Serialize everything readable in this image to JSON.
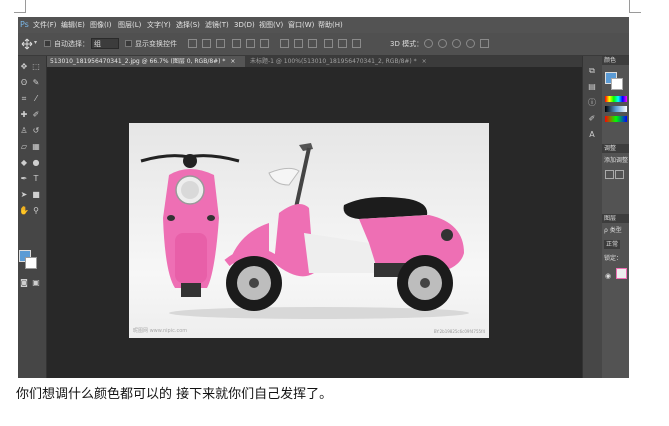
{
  "menubar": {
    "logo": "Ps",
    "items": [
      "文件(F)",
      "编辑(E)",
      "图像(I)",
      "图层(L)",
      "文字(Y)",
      "选择(S)",
      "滤镜(T)",
      "3D(D)",
      "视图(V)",
      "窗口(W)",
      "帮助(H)"
    ]
  },
  "options": {
    "auto_select_label": "自动选择：",
    "auto_select_value": "组",
    "show_transform_label": "显示变换控件",
    "mode_3d_label": "3D 模式："
  },
  "tabs": [
    {
      "label": "513010_181956470341_2.jpg @ 66.7% (图层 0, RGB/8#) *",
      "close": "×"
    },
    {
      "label": "未标题-1 @ 100%(513010_181956470341_2, RGB/8#) *",
      "close": "×"
    }
  ],
  "document": {
    "watermark": "昵图网 www.nipic.com",
    "image_id": "BY:2b19825c6c09f4755f4"
  },
  "panels": {
    "color_tab": "颜色",
    "adjust_tab": "调整",
    "adjust_text": "添加调整",
    "layers_tab": "图层",
    "kind_label": "ρ 类型",
    "blend_mode": "正常",
    "lock_label": "锁定："
  },
  "colors": {
    "foreground": "#5b9bd5",
    "background": "#ffffff",
    "scooter_pink": "#ee6fb4"
  },
  "caption": "你们想调什么颜色都可以的   接下来就你们自己发挥了。"
}
